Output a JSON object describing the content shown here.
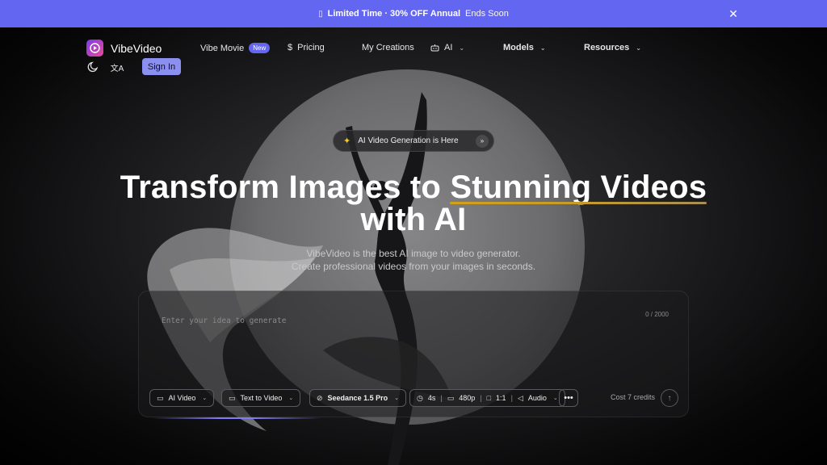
{
  "banner": {
    "gift_icon": "gift-icon",
    "text": "Limited Time · 30% OFF Annual",
    "ends": "Ends Soon",
    "close_icon": "close-icon",
    "color": "#6366f1"
  },
  "header": {
    "logo": {
      "name": "VibeVideo",
      "icon": "play-icon"
    },
    "nav": [
      {
        "label": "Vibe Movie",
        "badge": "New"
      },
      {
        "label": "Pricing",
        "icon": "dollar-icon"
      },
      {
        "label": "My Creations"
      },
      {
        "label": "AI",
        "icon": "robot-icon"
      },
      {
        "label": "Models"
      },
      {
        "label": "Resources"
      }
    ],
    "theme_icon": "moon-icon",
    "language_icon": "translate-icon",
    "signin_label": "Sign In"
  },
  "announcement": {
    "text": "AI Video Generation is Here",
    "icon": "sparkle-icon"
  },
  "hero": {
    "title_part1": "Transform Images to ",
    "title_highlight": "Stunning Videos",
    "title_line2": "with AI",
    "subtitle_line1": "VibeVideo is the best AI image to video generator.",
    "subtitle_line2": "Create professional videos from your images in seconds."
  },
  "prompt": {
    "placeholder": "Enter your idea to generate",
    "char_count": "0 / 2000",
    "controls": {
      "mode": "AI Video",
      "type": "Text to Video",
      "model": "Seedance 1.5 Pro",
      "duration": "4s",
      "resolution": "480p",
      "ratio": "1:1",
      "audio": "Audio"
    },
    "more_icon": "more-icon",
    "cost": "Cost 7 credits",
    "send_icon": "arrow-up-icon"
  }
}
